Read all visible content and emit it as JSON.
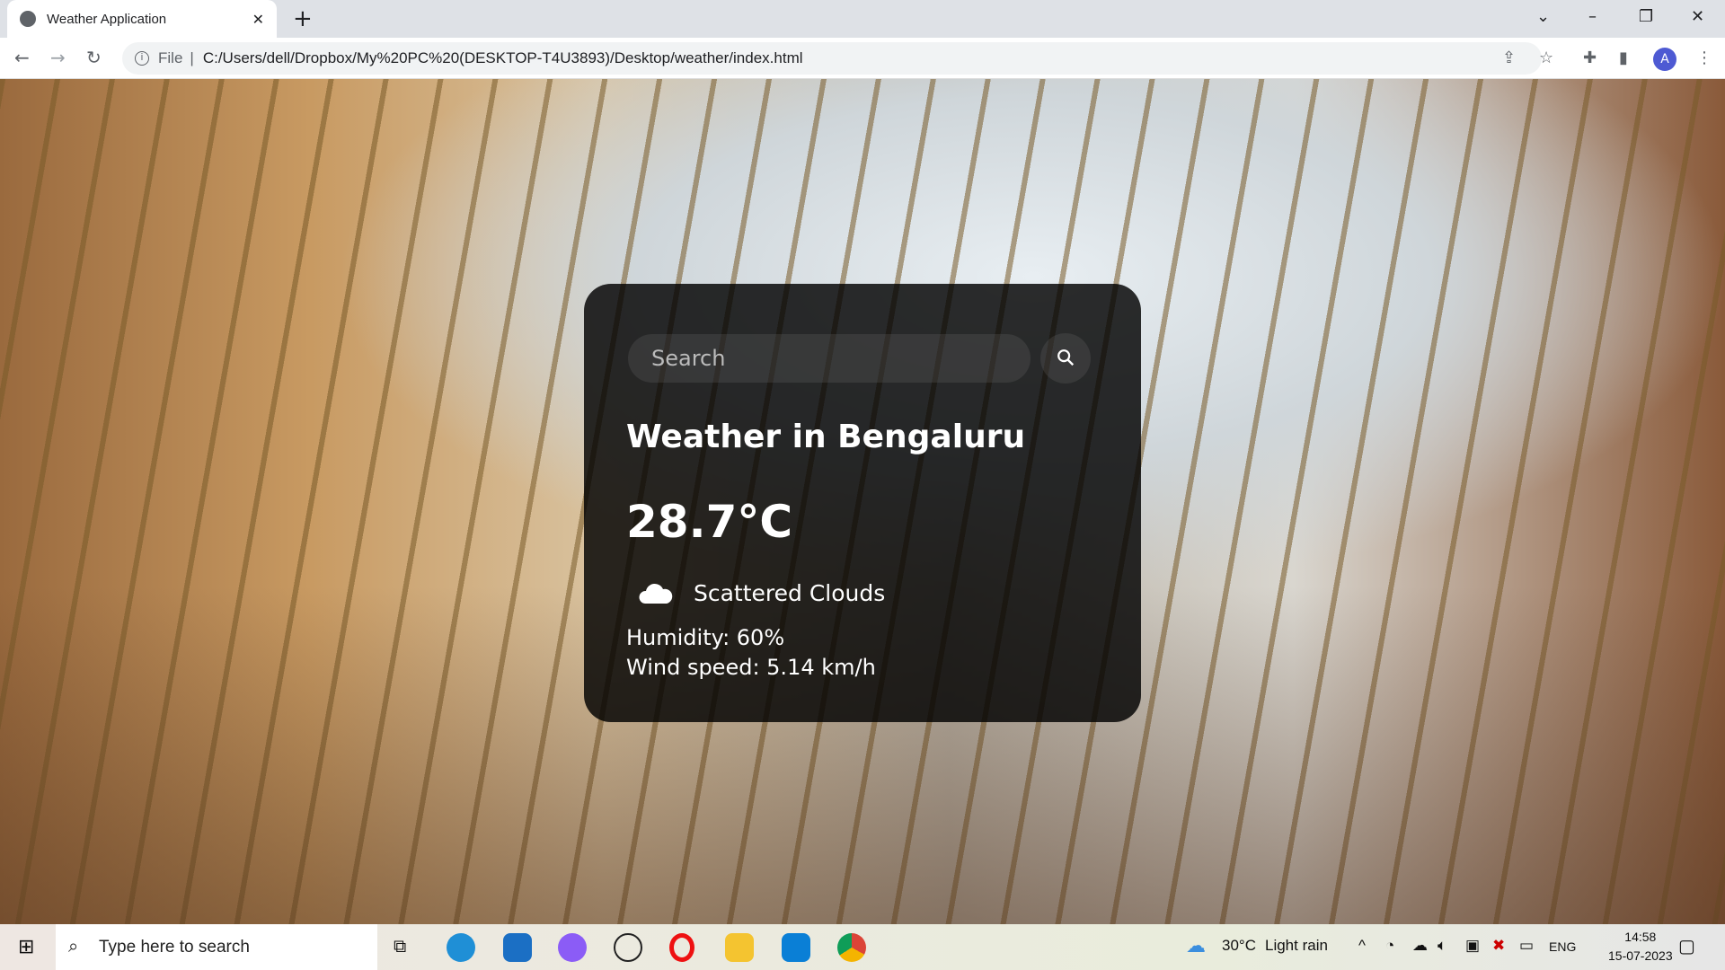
{
  "browser": {
    "tab_title": "Weather Application",
    "url_scheme": "File",
    "url": "C:/Users/dell/Dropbox/My%20PC%20(DESKTOP-T4U3893)/Desktop/weather/index.html",
    "profile_initial": "A"
  },
  "weather": {
    "search_placeholder": "Search",
    "city_title": "Weather in Bengaluru",
    "temperature": "28.7°C",
    "description": "Scattered Clouds",
    "humidity": "Humidity: 60%",
    "wind": "Wind speed: 5.14 km/h"
  },
  "taskbar": {
    "search_placeholder": "Type here to search",
    "weather_temp": "30°C",
    "weather_desc": "Light rain",
    "language": "ENG",
    "time": "14:58",
    "date": "15-07-2023"
  }
}
